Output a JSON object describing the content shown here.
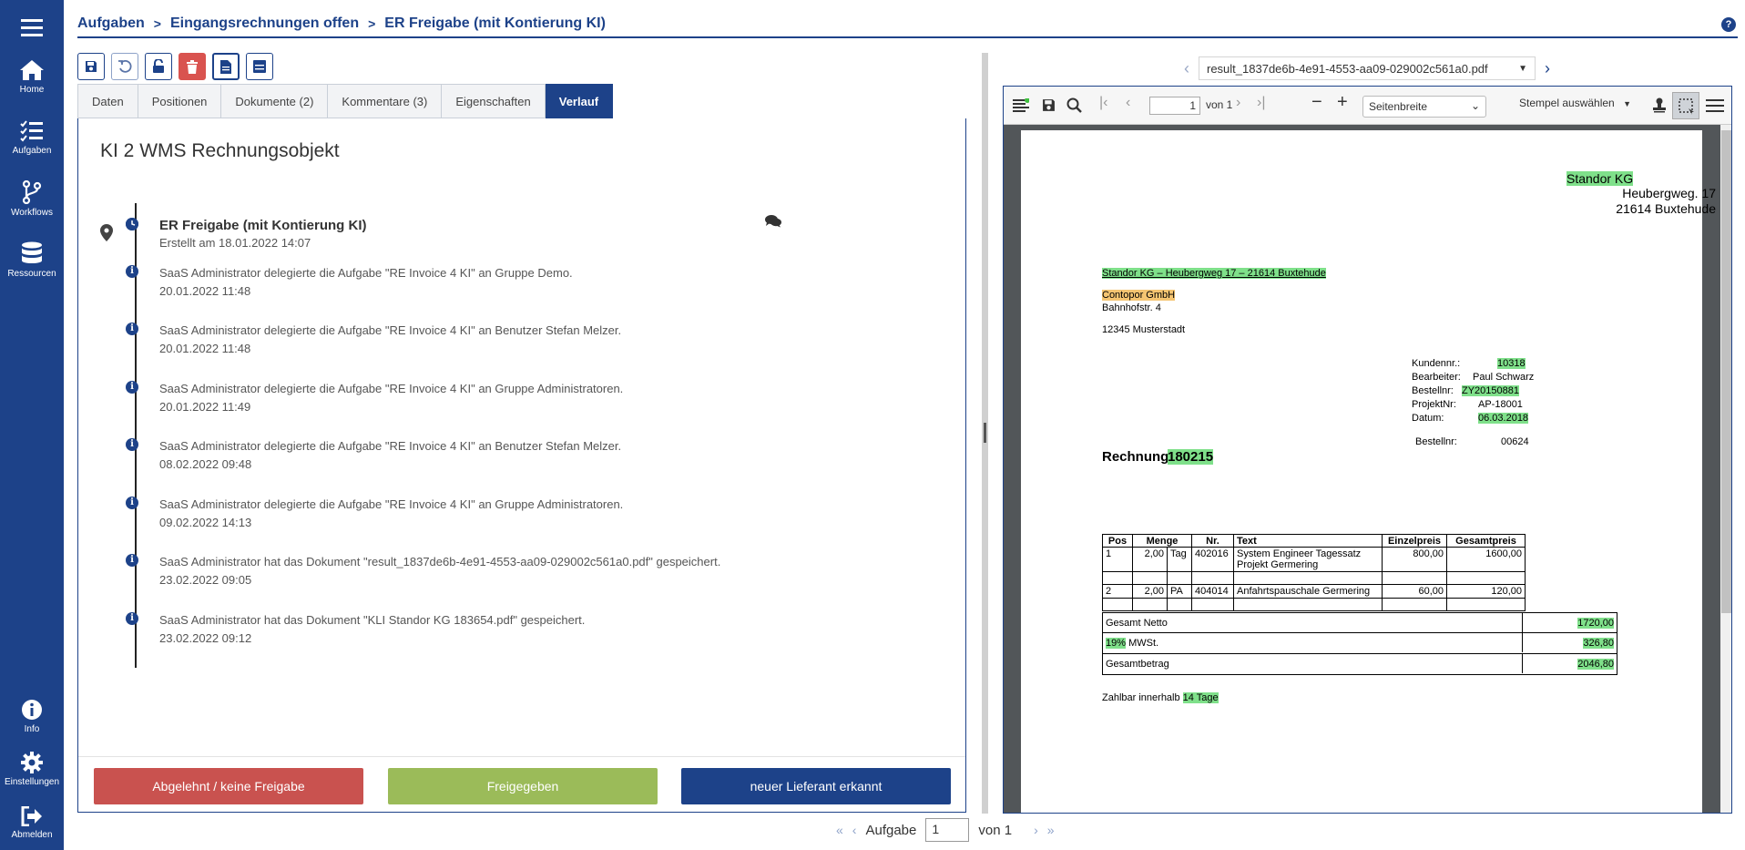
{
  "sidebar": {
    "items": [
      {
        "label": "Home",
        "icon": "home-icon"
      },
      {
        "label": "Aufgaben",
        "icon": "task-list-icon"
      },
      {
        "label": "Workflows",
        "icon": "workflow-icon"
      },
      {
        "label": "Ressourcen",
        "icon": "database-icon"
      }
    ],
    "bottom": [
      {
        "label": "Info",
        "icon": "info-icon"
      },
      {
        "label": "Einstellungen",
        "icon": "gear-icon"
      },
      {
        "label": "Abmelden",
        "icon": "logout-icon"
      }
    ],
    "color": "#1d4289"
  },
  "breadcrumb": {
    "items": [
      "Aufgaben",
      "Eingangsrechnungen offen",
      "ER Freigabe (mit Kontierung KI)"
    ],
    "separator": ">"
  },
  "help": {
    "label": "?"
  },
  "tabs": [
    {
      "label": "Daten",
      "active": false
    },
    {
      "label": "Positionen",
      "active": false
    },
    {
      "label": "Dokumente (2)",
      "active": false
    },
    {
      "label": "Kommentare (3)",
      "active": false
    },
    {
      "label": "Eigenschaften",
      "active": false
    },
    {
      "label": "Verlauf",
      "active": true
    }
  ],
  "panel": {
    "title": "KI 2 WMS Rechnungsobjekt",
    "head_event": {
      "title": "ER Freigabe (mit Kontierung KI)",
      "subtitle": "Erstellt am 18.01.2022 14:07"
    },
    "events": [
      {
        "text": "SaaS Administrator delegierte die Aufgabe \"RE Invoice 4 KI\" an Gruppe Demo.",
        "time": "20.01.2022 11:48"
      },
      {
        "text": "SaaS Administrator delegierte die Aufgabe \"RE Invoice 4 KI\" an Benutzer Stefan Melzer.",
        "time": "20.01.2022 11:48"
      },
      {
        "text": "SaaS Administrator delegierte die Aufgabe \"RE Invoice 4 KI\" an Gruppe Administratoren.",
        "time": "20.01.2022 11:49"
      },
      {
        "text": "SaaS Administrator delegierte die Aufgabe \"RE Invoice 4 KI\" an Benutzer Stefan Melzer.",
        "time": "08.02.2022 09:48"
      },
      {
        "text": "SaaS Administrator delegierte die Aufgabe \"RE Invoice 4 KI\" an Gruppe Administratoren.",
        "time": "09.02.2022 14:13"
      },
      {
        "text": "SaaS Administrator hat das Dokument \"result_1837de6b-4e91-4553-aa09-029002c561a0.pdf\" gespeichert.",
        "time": "23.02.2022 09:05"
      },
      {
        "text": "SaaS Administrator hat das Dokument \"KLI Standor KG 183654.pdf\" gespeichert.",
        "time": "23.02.2022 09:12"
      }
    ],
    "event_icon": "i"
  },
  "actions": {
    "reject": {
      "label": "Abgelehnt / keine Freigabe",
      "color": "#c9524f"
    },
    "approve": {
      "label": "Freigegeben",
      "color": "#9bbb59"
    },
    "new_supplier": {
      "label": "neuer Lieferant erkannt",
      "color": "#1d4289"
    }
  },
  "pdf": {
    "filename": "result_1837de6b-4e91-4553-aa09-029002c561a0.pdf",
    "page_input": "1",
    "page_of": "von 1",
    "zoom": "Seitenbreite",
    "stamp": "Stempel auswählen"
  },
  "invoice": {
    "sender_name": "Standor KG",
    "sender_street": "Heubergweg. 17",
    "sender_city": "21614 Buxtehude",
    "sender_line": "Standor KG – Heubergweg 17 – 21614 Buxtehude",
    "recipient_name": "Contopor GmbH",
    "recipient_street": "Bahnhofstr. 4",
    "recipient_city": "12345 Musterstadt",
    "meta": [
      {
        "label": "Kundennr.:",
        "value": "10318",
        "hl": true
      },
      {
        "label": "Bearbeiter:",
        "value": "Paul Schwarz",
        "hl": false
      },
      {
        "label": "Bestellnr:",
        "value": "ZY20150881",
        "hl": true
      },
      {
        "label": "ProjektNr:",
        "value": "AP-18001",
        "hl": false
      },
      {
        "label": "Datum:",
        "value": "06.03.2018",
        "hl": true
      }
    ],
    "order_label": "Bestellnr:",
    "order_value": "00624",
    "title": "Rechnung",
    "number": "180215",
    "columns": [
      "Pos",
      "Menge",
      "Nr.",
      "Text",
      "Einzelpreis",
      "Gesamtpreis"
    ],
    "rows": [
      {
        "pos": "1",
        "menge": "2,00",
        "unit": "Tag",
        "nr": "402016",
        "text1": "System Engineer Tagessatz",
        "text2": "Projekt Germering",
        "einzel": "800,00",
        "gesamt": "1600,00"
      },
      {
        "pos": "2",
        "menge": "2,00",
        "unit": "PA",
        "nr": "404014",
        "text1": "Anfahrtspauschale Germering",
        "text2": "",
        "einzel": "60,00",
        "gesamt": "120,00"
      }
    ],
    "net_label": "Gesamt Netto",
    "net_value": "1720,00",
    "vat_pct": "19%",
    "vat_label": " MWSt.",
    "vat_value": "326,80",
    "total_label": "Gesamtbetrag",
    "total_value": "2046,80",
    "payment_prefix": "Zahlbar innerhalb ",
    "payment_term": "14 Tage"
  },
  "pager": {
    "label": "Aufgabe",
    "value": "1",
    "of": "von 1"
  }
}
